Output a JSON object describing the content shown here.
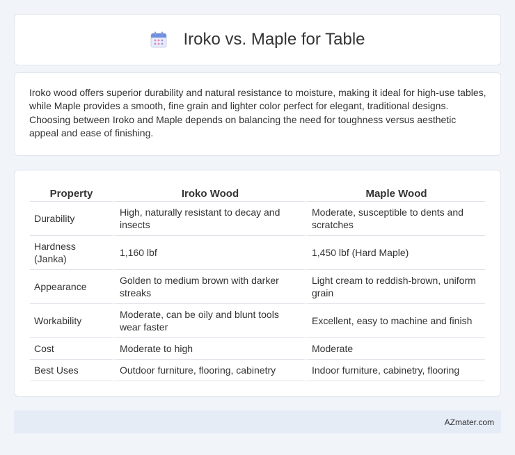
{
  "header": {
    "title": "Iroko vs. Maple for Table",
    "icon": "calendar-icon"
  },
  "description": "Iroko wood offers superior durability and natural resistance to moisture, making it ideal for high-use tables, while Maple provides a smooth, fine grain and lighter color perfect for elegant, traditional designs. Choosing between Iroko and Maple depends on balancing the need for toughness versus aesthetic appeal and ease of finishing.",
  "table": {
    "headers": [
      "Property",
      "Iroko Wood",
      "Maple Wood"
    ],
    "rows": [
      [
        "Durability",
        "High, naturally resistant to decay and insects",
        "Moderate, susceptible to dents and scratches"
      ],
      [
        "Hardness (Janka)",
        "1,160 lbf",
        "1,450 lbf (Hard Maple)"
      ],
      [
        "Appearance",
        "Golden to medium brown with darker streaks",
        "Light cream to reddish-brown, uniform grain"
      ],
      [
        "Workability",
        "Moderate, can be oily and blunt tools wear faster",
        "Excellent, easy to machine and finish"
      ],
      [
        "Cost",
        "Moderate to high",
        "Moderate"
      ],
      [
        "Best Uses",
        "Outdoor furniture, flooring, cabinetry",
        "Indoor furniture, cabinetry, flooring"
      ]
    ]
  },
  "footer": {
    "text": "AZmater.com"
  }
}
